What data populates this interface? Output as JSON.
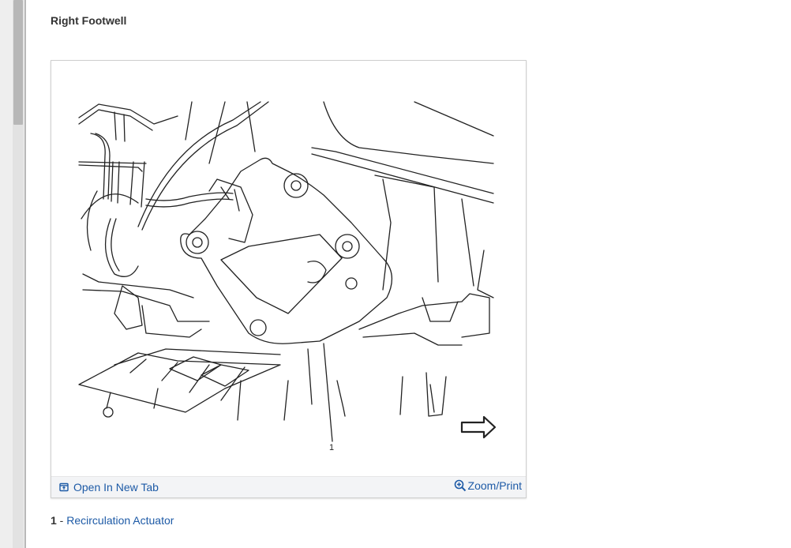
{
  "section": {
    "title": "Right Footwell"
  },
  "figure": {
    "callout": "1",
    "toolbar": {
      "open_tab_label": "Open In New Tab",
      "open_tab_icon": "open-new-tab-icon",
      "zoom_label": "Zoom/Print",
      "zoom_icon": "zoom-in-icon"
    }
  },
  "legend": {
    "items": [
      {
        "number": "1",
        "separator": " - ",
        "label": "Recirculation Actuator"
      }
    ]
  },
  "colors": {
    "link": "#1d5aa6",
    "text": "#333333",
    "toolbar_bg": "#f3f4f6"
  }
}
